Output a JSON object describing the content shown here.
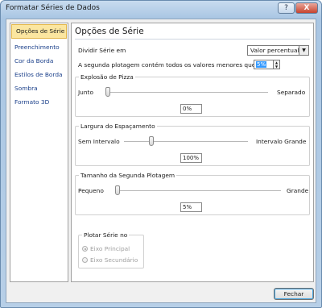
{
  "window": {
    "title": "Formatar Séries de Dados",
    "help_label": "?",
    "close_label": "X"
  },
  "nav": {
    "items": [
      {
        "label": "Opções de Série",
        "active": true
      },
      {
        "label": "Preenchimento"
      },
      {
        "label": "Cor da Borda"
      },
      {
        "label": "Estilos de Borda"
      },
      {
        "label": "Sombra"
      },
      {
        "label": "Formato 3D"
      }
    ]
  },
  "panel": {
    "title": "Opções de Série",
    "split_label": "Dividir Série em",
    "split_value": "Valor percentual",
    "second_plot_label": "A segunda plotagem contém todos os valores menores que",
    "second_plot_value": "5%",
    "explosion": {
      "title": "Explosão de Pizza",
      "min_label": "Junto",
      "max_label": "Separado",
      "value": "0%",
      "fraction": 0.0
    },
    "gap": {
      "title": "Largura do Espaçamento",
      "min_label": "Sem Intervalo",
      "max_label": "Intervalo Grande",
      "value": "100%",
      "fraction": 0.2
    },
    "second_size": {
      "title": "Tamanho da Segunda Plotagem",
      "min_label": "Pequeno",
      "max_label": "Grande",
      "value": "5%",
      "fraction": 0.0
    },
    "plot_on": {
      "title": "Plotar Série no",
      "primary": "Eixo Principal",
      "secondary": "Eixo Secundário"
    }
  },
  "footer": {
    "close_label": "Fechar"
  }
}
